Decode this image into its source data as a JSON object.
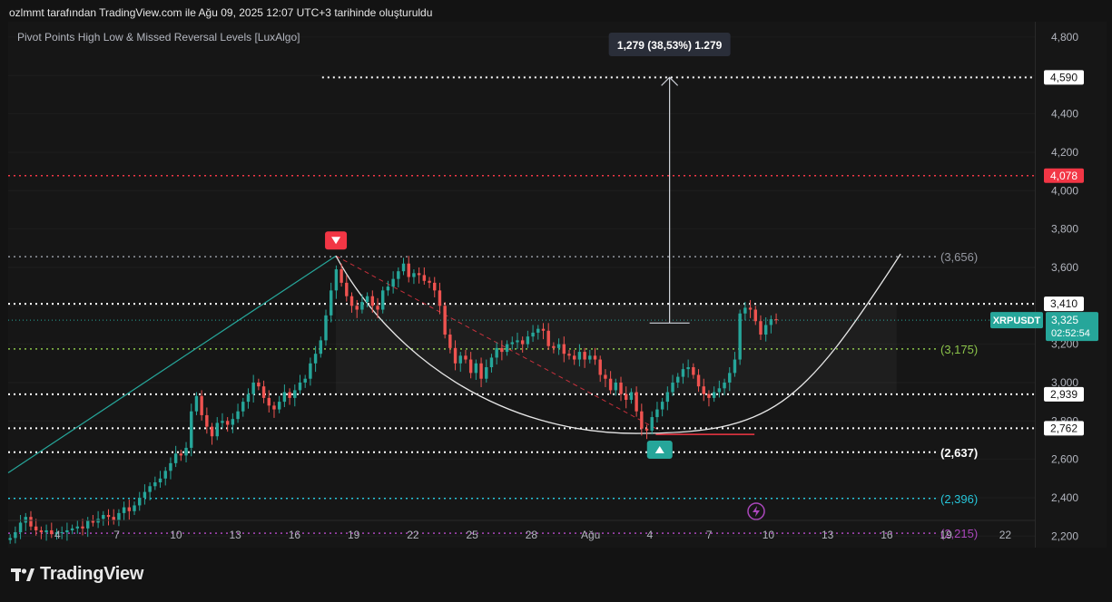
{
  "header": {
    "attribution": "ozlmmt tarafından TradingView.com ile Ağu 09, 2025 12:07 UTC+3 tarihinde oluşturuldu",
    "indicator": "Pivot Points High Low & Missed Reversal Levels [LuxAlgo]"
  },
  "brand": {
    "name": "TradingView"
  },
  "chart_data": {
    "type": "candlestick",
    "symbol": "XRPUSDT",
    "y_ticks": [
      "4,800",
      "4,600",
      "4,400",
      "4,200",
      "4,000",
      "3,800",
      "3,600",
      "3,400",
      "3,200",
      "3,000",
      "2,800",
      "2,600",
      "2,400",
      "2,200"
    ],
    "y_tick_values": [
      4.8,
      4.6,
      4.4,
      4.2,
      4.0,
      3.8,
      3.6,
      3.4,
      3.2,
      3.0,
      2.8,
      2.6,
      2.4,
      2.2
    ],
    "ylim": [
      2.14,
      4.88
    ],
    "x_ticks": [
      "4",
      "7",
      "10",
      "13",
      "16",
      "19",
      "22",
      "25",
      "28",
      "Ağu",
      "4",
      "7",
      "10",
      "13",
      "16",
      "19",
      "22"
    ],
    "x_tick_days": [
      4,
      7,
      10,
      13,
      16,
      19,
      22,
      25,
      28,
      31,
      34,
      37,
      40,
      43,
      46,
      49,
      52
    ],
    "x_range_days": [
      1.5,
      53.5
    ],
    "x_axis_note": "days from July 1 (2025); Ağu = Aug 1",
    "last_price": {
      "label": "XRPUSDT",
      "value": "3,325",
      "countdown": "02:52:54",
      "level": 3.325
    },
    "horizontal_levels": [
      {
        "label": "4,590",
        "value": 4.59,
        "color": "#ffffff",
        "tag": "axis"
      },
      {
        "label": "4,078",
        "value": 4.078,
        "color": "#f23645",
        "tag": "axis"
      },
      {
        "label": "(3,656)",
        "value": 3.656,
        "color": "#9598a1",
        "tag": "inline"
      },
      {
        "label": "3,410",
        "value": 3.41,
        "color": "#ffffff",
        "tag": "axis"
      },
      {
        "label": "(3,175)",
        "value": 3.175,
        "color": "#8bc34a",
        "tag": "inline"
      },
      {
        "label": "2,939",
        "value": 2.939,
        "color": "#ffffff",
        "tag": "axis"
      },
      {
        "label": "2,762",
        "value": 2.762,
        "color": "#ffffff",
        "tag": "axis"
      },
      {
        "label": "(2,637)",
        "value": 2.637,
        "color": "#ffffff",
        "tag": "inline"
      },
      {
        "label": "(2,396)",
        "value": 2.396,
        "color": "#26c6da",
        "tag": "inline"
      },
      {
        "label": "(2,215)",
        "value": 2.215,
        "color": "#ab47bc",
        "tag": "inline"
      }
    ],
    "measure": {
      "label": "1,279 (38,53%) 1.279",
      "from": 3.31,
      "to": 4.59,
      "day": 35.0
    },
    "pivot_high": {
      "day": 18.1,
      "value": 3.66
    },
    "pivot_low": {
      "day": 34.5,
      "value": 2.74
    },
    "trend_line": {
      "from_day": 1.5,
      "from_value": 2.53,
      "to_day": 18.1,
      "to_value": 3.66
    },
    "dashed_line": {
      "from_day": 18.1,
      "from_value": 3.66,
      "to_day": 34.5,
      "to_value": 2.75
    },
    "red_line": {
      "from_day": 34.3,
      "to_day": 39.3,
      "value": 2.73
    },
    "arc": {
      "start_day": 18.1,
      "start_value": 3.66,
      "bottom_day": 33.3,
      "bottom_value": 2.735,
      "end_day": 46.7,
      "end_value": 3.67
    },
    "closes": [
      2.19,
      2.22,
      2.27,
      2.3,
      2.25,
      2.23,
      2.22,
      2.23,
      2.21,
      2.22,
      2.22,
      2.23,
      2.24,
      2.25,
      2.24,
      2.28,
      2.27,
      2.29,
      2.31,
      2.3,
      2.28,
      2.32,
      2.35,
      2.33,
      2.36,
      2.4,
      2.43,
      2.46,
      2.48,
      2.5,
      2.54,
      2.58,
      2.63,
      2.62,
      2.66,
      2.85,
      2.93,
      2.83,
      2.77,
      2.72,
      2.79,
      2.8,
      2.78,
      2.81,
      2.85,
      2.9,
      2.94,
      3.0,
      2.98,
      2.92,
      2.88,
      2.86,
      2.9,
      2.95,
      2.92,
      2.96,
      3.0,
      3.02,
      3.1,
      3.15,
      3.22,
      3.35,
      3.48,
      3.59,
      3.52,
      3.45,
      3.4,
      3.38,
      3.42,
      3.45,
      3.4,
      3.38,
      3.48,
      3.5,
      3.54,
      3.58,
      3.62,
      3.55,
      3.57,
      3.56,
      3.53,
      3.52,
      3.48,
      3.4,
      3.25,
      3.18,
      3.1,
      3.14,
      3.12,
      3.05,
      3.1,
      3.02,
      3.08,
      3.13,
      3.18,
      3.16,
      3.2,
      3.21,
      3.22,
      3.2,
      3.24,
      3.26,
      3.28,
      3.27,
      3.19,
      3.18,
      3.2,
      3.15,
      3.14,
      3.12,
      3.16,
      3.12,
      3.14,
      3.12,
      3.04,
      3.02,
      2.96,
      3.0,
      2.94,
      2.91,
      2.95,
      2.85,
      2.76,
      2.75,
      2.82,
      2.86,
      2.9,
      2.95,
      3.0,
      3.03,
      3.07,
      3.08,
      3.04,
      2.98,
      2.94,
      2.92,
      2.95,
      2.97,
      3.0,
      3.05,
      3.12,
      3.36,
      3.39,
      3.38,
      3.32,
      3.25,
      3.3,
      3.33,
      3.325
    ]
  }
}
